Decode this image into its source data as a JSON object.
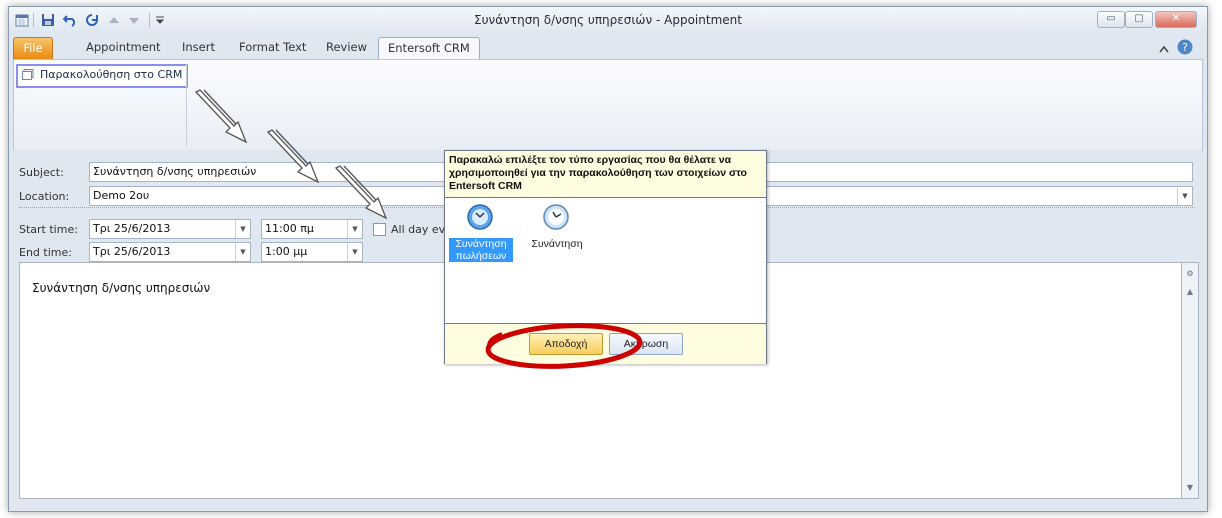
{
  "window": {
    "title": "Συνάντηση δ/νσης υπηρεσιών  -  Appointment",
    "controls": {
      "minimize": "▭",
      "restore": "▢",
      "close": "✕"
    }
  },
  "tabs": [
    {
      "label": "File"
    },
    {
      "label": "Appointment"
    },
    {
      "label": "Insert"
    },
    {
      "label": "Format Text"
    },
    {
      "label": "Review"
    },
    {
      "label": "Entersoft CRM"
    }
  ],
  "ribbon": {
    "crm_track_label": "Παρακολούθηση στο CRM"
  },
  "form": {
    "subject_label": "Subject:",
    "subject_value": "Συνάντηση δ/νσης υπηρεσιών",
    "location_label": "Location:",
    "location_value": "Demo 2ου",
    "start_label": "Start time:",
    "start_date": "Τρι 25/6/2013",
    "start_time": "11:00 πμ",
    "end_label": "End time:",
    "end_date": "Τρι 25/6/2013",
    "end_time": "1:00 μμ",
    "allday_label": "All day eve",
    "body_text": "Συνάντηση δ/νσης υπηρεσιών"
  },
  "dialog": {
    "prompt": "Παρακαλώ επιλέξτε τον τύπο εργασίας που θα θέλατε να χρησιμοποιηθεί για την παρακολούθηση των στοιχείων στο Entersoft CRM",
    "items": [
      {
        "label": "Συνάντηση πωλήσεων",
        "selected": true
      },
      {
        "label": "Συνάντηση",
        "selected": false
      }
    ],
    "accept_label": "Αποδοχή",
    "cancel_label": "Ακύρωση"
  },
  "colors": {
    "accent_file": "#e88a12",
    "selection": "#3399ff",
    "highlight": "#cc0000",
    "focus_border": "#8a8ef0"
  }
}
